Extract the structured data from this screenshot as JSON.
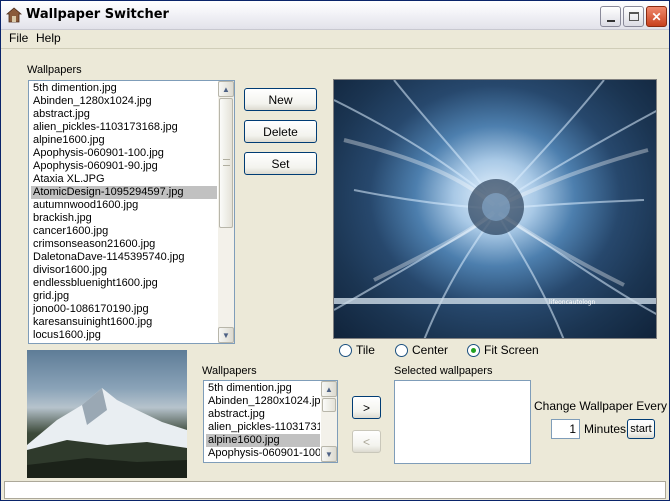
{
  "window": {
    "title": "Wallpaper Switcher"
  },
  "menu": [
    "File",
    "Help"
  ],
  "wallpapers_label": "Wallpapers",
  "wallpapers_list": [
    "5th dimention.jpg",
    "Abinden_1280x1024.jpg",
    "abstract.jpg",
    "alien_pickles-1103173168.jpg",
    "alpine1600.jpg",
    "Apophysis-060901-100.jpg",
    "Apophysis-060901-90.jpg",
    "Ataxia XL.JPG",
    "AtomicDesign-1095294597.jpg",
    "autumnwood1600.jpg",
    "brackish.jpg",
    "cancer1600.jpg",
    "crimsonseason21600.jpg",
    "DaletonaDave-1145395740.jpg",
    "divisor1600.jpg",
    "endlessbluenight1600.jpg",
    "grid.jpg",
    "jono00-1086170190.jpg",
    "karesansuinight1600.jpg",
    "locus1600.jpg"
  ],
  "wallpapers_selected_index": 8,
  "buttons": {
    "new": "New",
    "delete": "Delete",
    "set": "Set"
  },
  "preview_watermark": "lifeoncautologn",
  "display_modes": [
    {
      "label": "Tile",
      "checked": false
    },
    {
      "label": "Center",
      "checked": false
    },
    {
      "label": "Fit Screen",
      "checked": true
    }
  ],
  "rotation_label": "Wallpapers",
  "rotation_list": [
    "5th dimention.jpg",
    "Abinden_1280x1024.jpg",
    "abstract.jpg",
    "alien_pickles-11031731",
    "alpine1600.jpg",
    "Apophysis-060901-100."
  ],
  "rotation_selected_index": 4,
  "add_button": ">",
  "remove_button": "<",
  "selected_label": "Selected wallpapers",
  "selected_list": [],
  "change_label": "Change Wallpaper Every",
  "interval_value": "1",
  "minutes_label": "Minutes",
  "start_button": "start",
  "status_text": ""
}
